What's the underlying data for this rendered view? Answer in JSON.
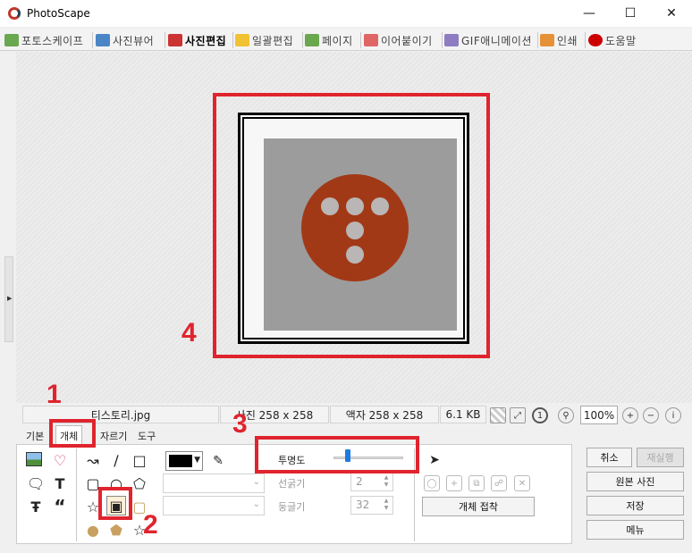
{
  "window": {
    "title": "PhotoScape"
  },
  "tabs": [
    {
      "label": "포토스케이프",
      "icon": "photoscape-book-icon",
      "color": "#6aa84f"
    },
    {
      "label": "사진뷰어",
      "icon": "photo-viewer-icon",
      "color": "#4a86c5"
    },
    {
      "label": "사진편집",
      "icon": "photo-editor-icon",
      "color": "#cc3333",
      "active": true
    },
    {
      "label": "일괄편집",
      "icon": "batch-edit-icon",
      "color": "#f1c232"
    },
    {
      "label": "페이지",
      "icon": "page-icon",
      "color": "#6aa84f"
    },
    {
      "label": "이어붙이기",
      "icon": "combine-icon",
      "color": "#e06666"
    },
    {
      "label": "GIF애니메이션",
      "icon": "gif-animation-icon",
      "color": "#8e7cc3"
    },
    {
      "label": "인쇄",
      "icon": "print-icon",
      "color": "#e69138"
    },
    {
      "label": "도움말",
      "icon": "help-icon",
      "color": "#cc0000"
    }
  ],
  "status": {
    "filename": "티스토리.jpg",
    "photo_size": "사진 258 x 258",
    "frame_size": "액자 258 x 258",
    "file_size": "6.1 KB",
    "zoom": "100%"
  },
  "subtabs": [
    "기본",
    "개체",
    "자르기",
    "도구"
  ],
  "object_panel": {
    "opacity_label": "투명도",
    "opacity_value": 0.2,
    "line_width_label": "선굵기",
    "line_width_value": "2",
    "roundness_label": "둥글기",
    "roundness_value": "32",
    "stick_button": "개체 접착",
    "color": "#000000"
  },
  "side_buttons": {
    "cancel": "취소",
    "redo": "재실행",
    "original": "원본 사진",
    "save": "저장",
    "menu": "메뉴"
  },
  "annotations": [
    "1",
    "2",
    "3",
    "4"
  ],
  "accent": "#e0242e"
}
